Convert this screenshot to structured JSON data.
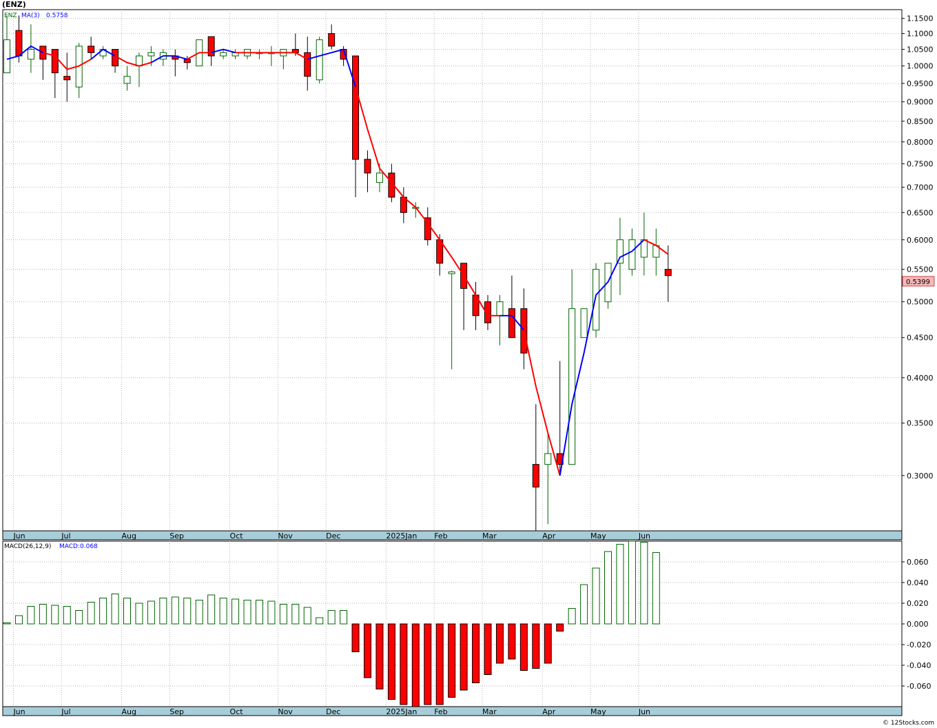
{
  "title": "(ENZ)",
  "footer": "© 12Stocks.com",
  "colors": {
    "up": "#006400",
    "down": "#ff0000",
    "ma_up": "#0000ff",
    "ma_down": "#ff0000",
    "axis_band": "#a7cdd9",
    "grid": "#b5b5b5",
    "last_price_box": "#f4b8b8"
  },
  "price_panel": {
    "legend_symbol": "ENZ",
    "legend_ma": "MA(3)",
    "legend_ma_value": "0.5758",
    "last_price": "0.5399"
  },
  "macd_panel": {
    "legend_name": "MACD(26,12,9)",
    "legend_value": "MACD:0.068"
  },
  "chart_data": [
    {
      "type": "candlestick",
      "title": "(ENZ)",
      "scale": "log",
      "ylim": [
        0.255,
        1.18
      ],
      "y_ticks": [
        "1.1500",
        "1.1000",
        "1.0500",
        "1.0000",
        "0.9500",
        "0.9000",
        "0.8500",
        "0.8000",
        "0.7500",
        "0.7000",
        "0.6500",
        "0.6000",
        "0.5500",
        "0.5000",
        "0.4500",
        "0.4000",
        "0.3500",
        "0.3000"
      ],
      "x_labels": [
        "Jun",
        "Jul",
        "Aug",
        "Sep",
        "Oct",
        "Nov",
        "Dec",
        "2025Jan",
        "Feb",
        "Mar",
        "Apr",
        "May",
        "Jun"
      ],
      "x_label_week_index": [
        1,
        5,
        10,
        14,
        19,
        23,
        27,
        32,
        36,
        40,
        45,
        49,
        53
      ],
      "ohlc": [
        [
          0.98,
          1.16,
          0.98,
          1.08
        ],
        [
          1.11,
          1.16,
          1.01,
          1.03
        ],
        [
          1.02,
          1.13,
          0.98,
          1.05
        ],
        [
          1.06,
          1.06,
          0.96,
          1.02
        ],
        [
          1.05,
          1.05,
          0.91,
          0.98
        ],
        [
          0.97,
          1.04,
          0.9,
          0.96
        ],
        [
          0.94,
          1.07,
          0.91,
          1.06
        ],
        [
          1.06,
          1.09,
          1.02,
          1.04
        ],
        [
          1.03,
          1.06,
          1.02,
          1.05
        ],
        [
          1.05,
          1.05,
          0.98,
          1.0
        ],
        [
          0.95,
          1.0,
          0.93,
          0.97
        ],
        [
          1.0,
          1.04,
          0.94,
          1.03
        ],
        [
          1.03,
          1.06,
          1.0,
          1.04
        ],
        [
          1.02,
          1.05,
          1.0,
          1.04
        ],
        [
          1.03,
          1.05,
          0.97,
          1.02
        ],
        [
          1.02,
          1.03,
          0.99,
          1.01
        ],
        [
          1.0,
          1.08,
          1.0,
          1.08
        ],
        [
          1.09,
          1.09,
          1.0,
          1.03
        ],
        [
          1.03,
          1.05,
          1.02,
          1.04
        ],
        [
          1.03,
          1.05,
          1.02,
          1.04
        ],
        [
          1.03,
          1.05,
          1.02,
          1.05
        ],
        [
          1.04,
          1.05,
          1.02,
          1.04
        ],
        [
          1.04,
          1.06,
          1.0,
          1.04
        ],
        [
          1.03,
          1.05,
          0.99,
          1.05
        ],
        [
          1.05,
          1.1,
          1.03,
          1.04
        ],
        [
          1.04,
          1.09,
          0.93,
          0.97
        ],
        [
          0.96,
          1.09,
          0.95,
          1.08
        ],
        [
          1.1,
          1.13,
          1.05,
          1.06
        ],
        [
          1.05,
          1.06,
          1.0,
          1.02
        ],
        [
          1.03,
          1.03,
          0.68,
          0.76
        ],
        [
          0.76,
          0.78,
          0.69,
          0.73
        ],
        [
          0.71,
          0.75,
          0.69,
          0.73
        ],
        [
          0.73,
          0.75,
          0.67,
          0.68
        ],
        [
          0.68,
          0.7,
          0.63,
          0.65
        ],
        [
          0.66,
          0.67,
          0.64,
          0.66
        ],
        [
          0.64,
          0.66,
          0.59,
          0.6
        ],
        [
          0.6,
          0.61,
          0.54,
          0.56
        ],
        [
          0.543,
          0.548,
          0.41,
          0.546
        ],
        [
          0.56,
          0.56,
          0.46,
          0.52
        ],
        [
          0.51,
          0.53,
          0.46,
          0.48
        ],
        [
          0.5,
          0.51,
          0.46,
          0.47
        ],
        [
          0.48,
          0.51,
          0.44,
          0.5
        ],
        [
          0.49,
          0.54,
          0.45,
          0.45
        ],
        [
          0.49,
          0.52,
          0.41,
          0.43
        ],
        [
          0.31,
          0.37,
          0.25,
          0.29
        ],
        [
          0.31,
          0.34,
          0.26,
          0.32
        ],
        [
          0.32,
          0.42,
          0.3,
          0.31
        ],
        [
          0.31,
          0.55,
          0.31,
          0.49
        ],
        [
          0.45,
          0.49,
          0.45,
          0.49
        ],
        [
          0.46,
          0.56,
          0.45,
          0.55
        ],
        [
          0.5,
          0.56,
          0.49,
          0.56
        ],
        [
          0.56,
          0.64,
          0.51,
          0.6
        ],
        [
          0.55,
          0.62,
          0.54,
          0.6
        ],
        [
          0.57,
          0.65,
          0.54,
          0.6
        ],
        [
          0.57,
          0.62,
          0.54,
          0.59
        ],
        [
          0.55,
          0.59,
          0.5,
          0.54
        ]
      ],
      "ma3": [
        1.02,
        1.03,
        1.06,
        1.04,
        1.03,
        0.99,
        1.0,
        1.02,
        1.05,
        1.03,
        1.01,
        1.0,
        1.01,
        1.03,
        1.03,
        1.02,
        1.04,
        1.04,
        1.05,
        1.04,
        1.04,
        1.04,
        1.04,
        1.04,
        1.04,
        1.02,
        1.03,
        1.04,
        1.05,
        0.94,
        0.83,
        0.74,
        0.71,
        0.68,
        0.66,
        0.63,
        0.6,
        0.57,
        0.54,
        0.51,
        0.48,
        0.48,
        0.48,
        0.46,
        0.39,
        0.34,
        0.3,
        0.37,
        0.43,
        0.51,
        0.53,
        0.57,
        0.58,
        0.6,
        0.59,
        0.575
      ],
      "ma3_color_switch": [
        [
          0,
          3,
          "up"
        ],
        [
          3,
          7,
          "down"
        ],
        [
          7,
          9,
          "up"
        ],
        [
          9,
          12,
          "down"
        ],
        [
          12,
          15,
          "up"
        ],
        [
          15,
          17,
          "down"
        ],
        [
          17,
          19,
          "up"
        ],
        [
          19,
          25,
          "down"
        ],
        [
          25,
          29,
          "up"
        ],
        [
          29,
          41,
          "down"
        ],
        [
          41,
          43,
          "up"
        ],
        [
          43,
          46,
          "down"
        ],
        [
          46,
          53,
          "up"
        ],
        [
          53,
          55,
          "down"
        ]
      ]
    },
    {
      "type": "bar",
      "title": "MACD(26,12,9)",
      "ylim": [
        -0.08,
        0.08
      ],
      "y_ticks": [
        "0.060",
        "0.040",
        "0.020",
        "0.000",
        "-0.020",
        "-0.040",
        "-0.060"
      ],
      "values": [
        0.001,
        0.008,
        0.017,
        0.019,
        0.018,
        0.017,
        0.013,
        0.021,
        0.025,
        0.029,
        0.025,
        0.02,
        0.022,
        0.025,
        0.026,
        0.025,
        0.023,
        0.028,
        0.025,
        0.024,
        0.023,
        0.023,
        0.022,
        0.019,
        0.019,
        0.016,
        0.006,
        0.013,
        0.013,
        -0.027,
        -0.052,
        -0.063,
        -0.073,
        -0.078,
        -0.08,
        -0.078,
        -0.078,
        -0.071,
        -0.064,
        -0.057,
        -0.049,
        -0.038,
        -0.034,
        -0.045,
        -0.043,
        -0.038,
        -0.007,
        0.015,
        0.038,
        0.054,
        0.07,
        0.077,
        0.08,
        0.079,
        0.069
      ]
    }
  ]
}
